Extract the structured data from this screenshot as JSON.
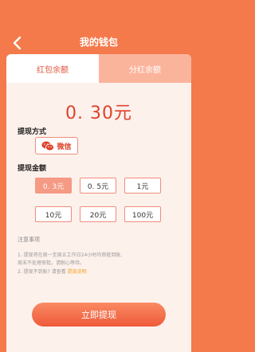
{
  "header": {
    "title": "我的钱包"
  },
  "tabs": [
    {
      "label": "红包余额",
      "active": true
    },
    {
      "label": "分红余额",
      "active": false
    }
  ],
  "balance": {
    "value": "0. 30元"
  },
  "method_section": {
    "label": "提现方式",
    "option_label": "微信",
    "option_icon": "wechat-icon"
  },
  "amount_section": {
    "label": "提现金额",
    "options": [
      "0. 3元",
      "0. 5元",
      "1元",
      "10元",
      "20元",
      "100元"
    ],
    "selected_index": 0
  },
  "notes": {
    "title": "注意事项",
    "line1": "1. 提现将在周一至周五工作日24小时内审批到账,",
    "line2": "周末不处理审批，请耐心等待。",
    "line3_prefix": "2. 提现不到账? 请查看",
    "line3_link": "提现说明"
  },
  "submit": {
    "label": "立即提现"
  },
  "colors": {
    "accent": "#f47a4c",
    "price": "#e0412b",
    "selected": "#f59a84",
    "link": "#f0a020"
  }
}
